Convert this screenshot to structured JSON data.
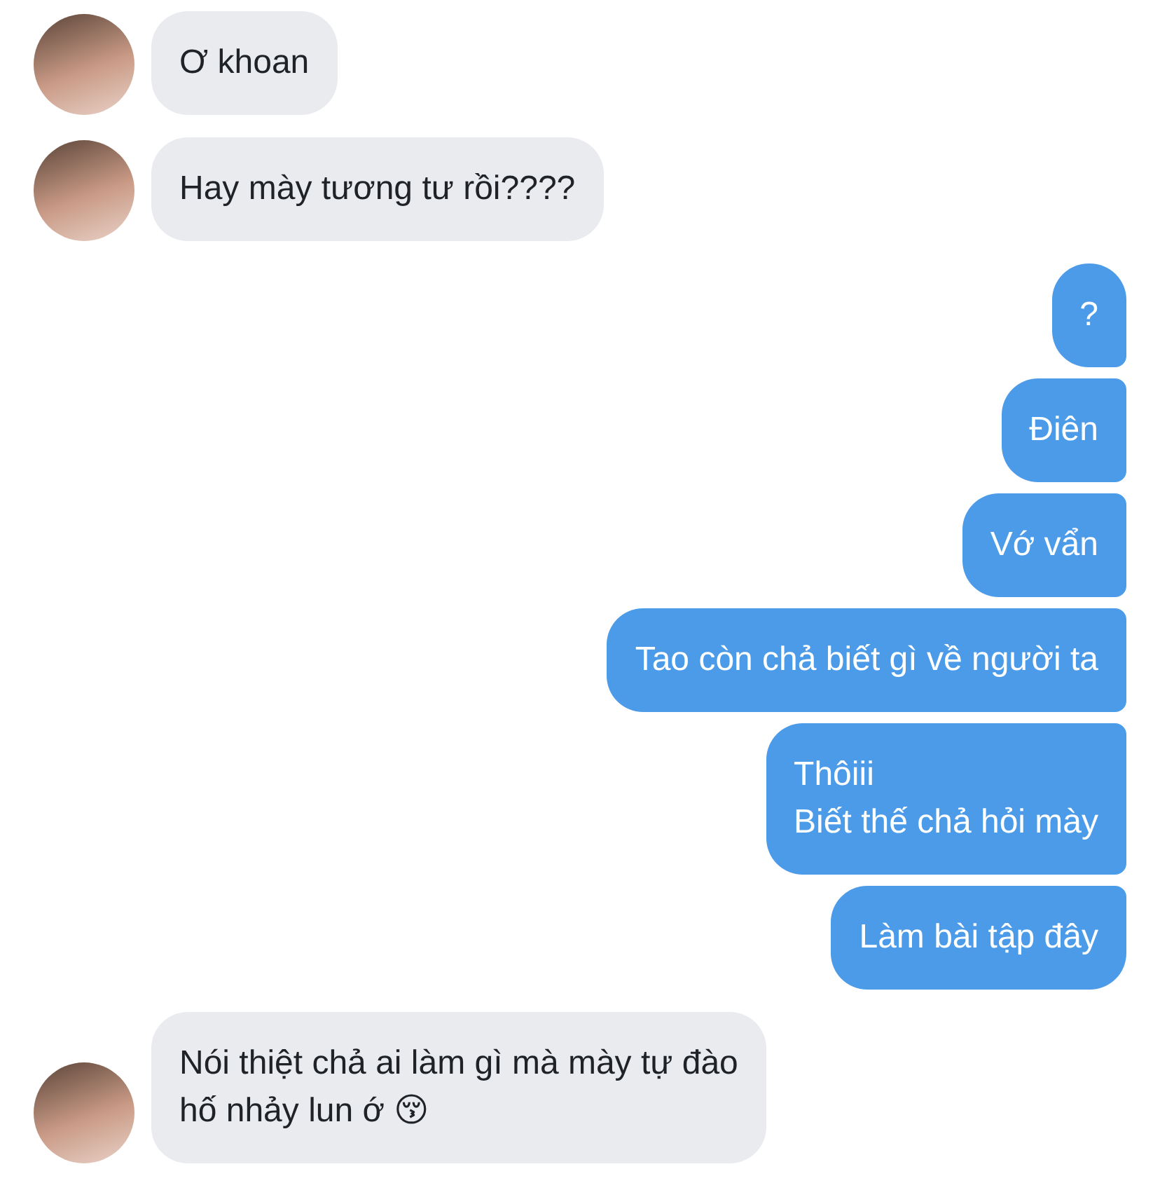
{
  "messages": [
    {
      "kind": "received",
      "lines": [
        "Ơ khoan"
      ]
    },
    {
      "kind": "received",
      "lines": [
        "Hay mày tương tư rồi????"
      ]
    },
    {
      "kind": "sent",
      "lines": [
        "?"
      ]
    },
    {
      "kind": "sent",
      "lines": [
        "Điên"
      ]
    },
    {
      "kind": "sent",
      "lines": [
        "Vớ vẩn"
      ]
    },
    {
      "kind": "sent",
      "lines": [
        "Tao còn chả biết gì về người ta"
      ]
    },
    {
      "kind": "sent",
      "lines": [
        "Thôiii",
        "Biết thế chả hỏi mày"
      ]
    },
    {
      "kind": "sent",
      "lines": [
        "Làm bài tập đây"
      ]
    },
    {
      "kind": "received",
      "lines": [
        "Nói thiệt chả ai làm gì mà mày tự đào",
        "hố nhảy lun ớ 😚"
      ]
    }
  ]
}
